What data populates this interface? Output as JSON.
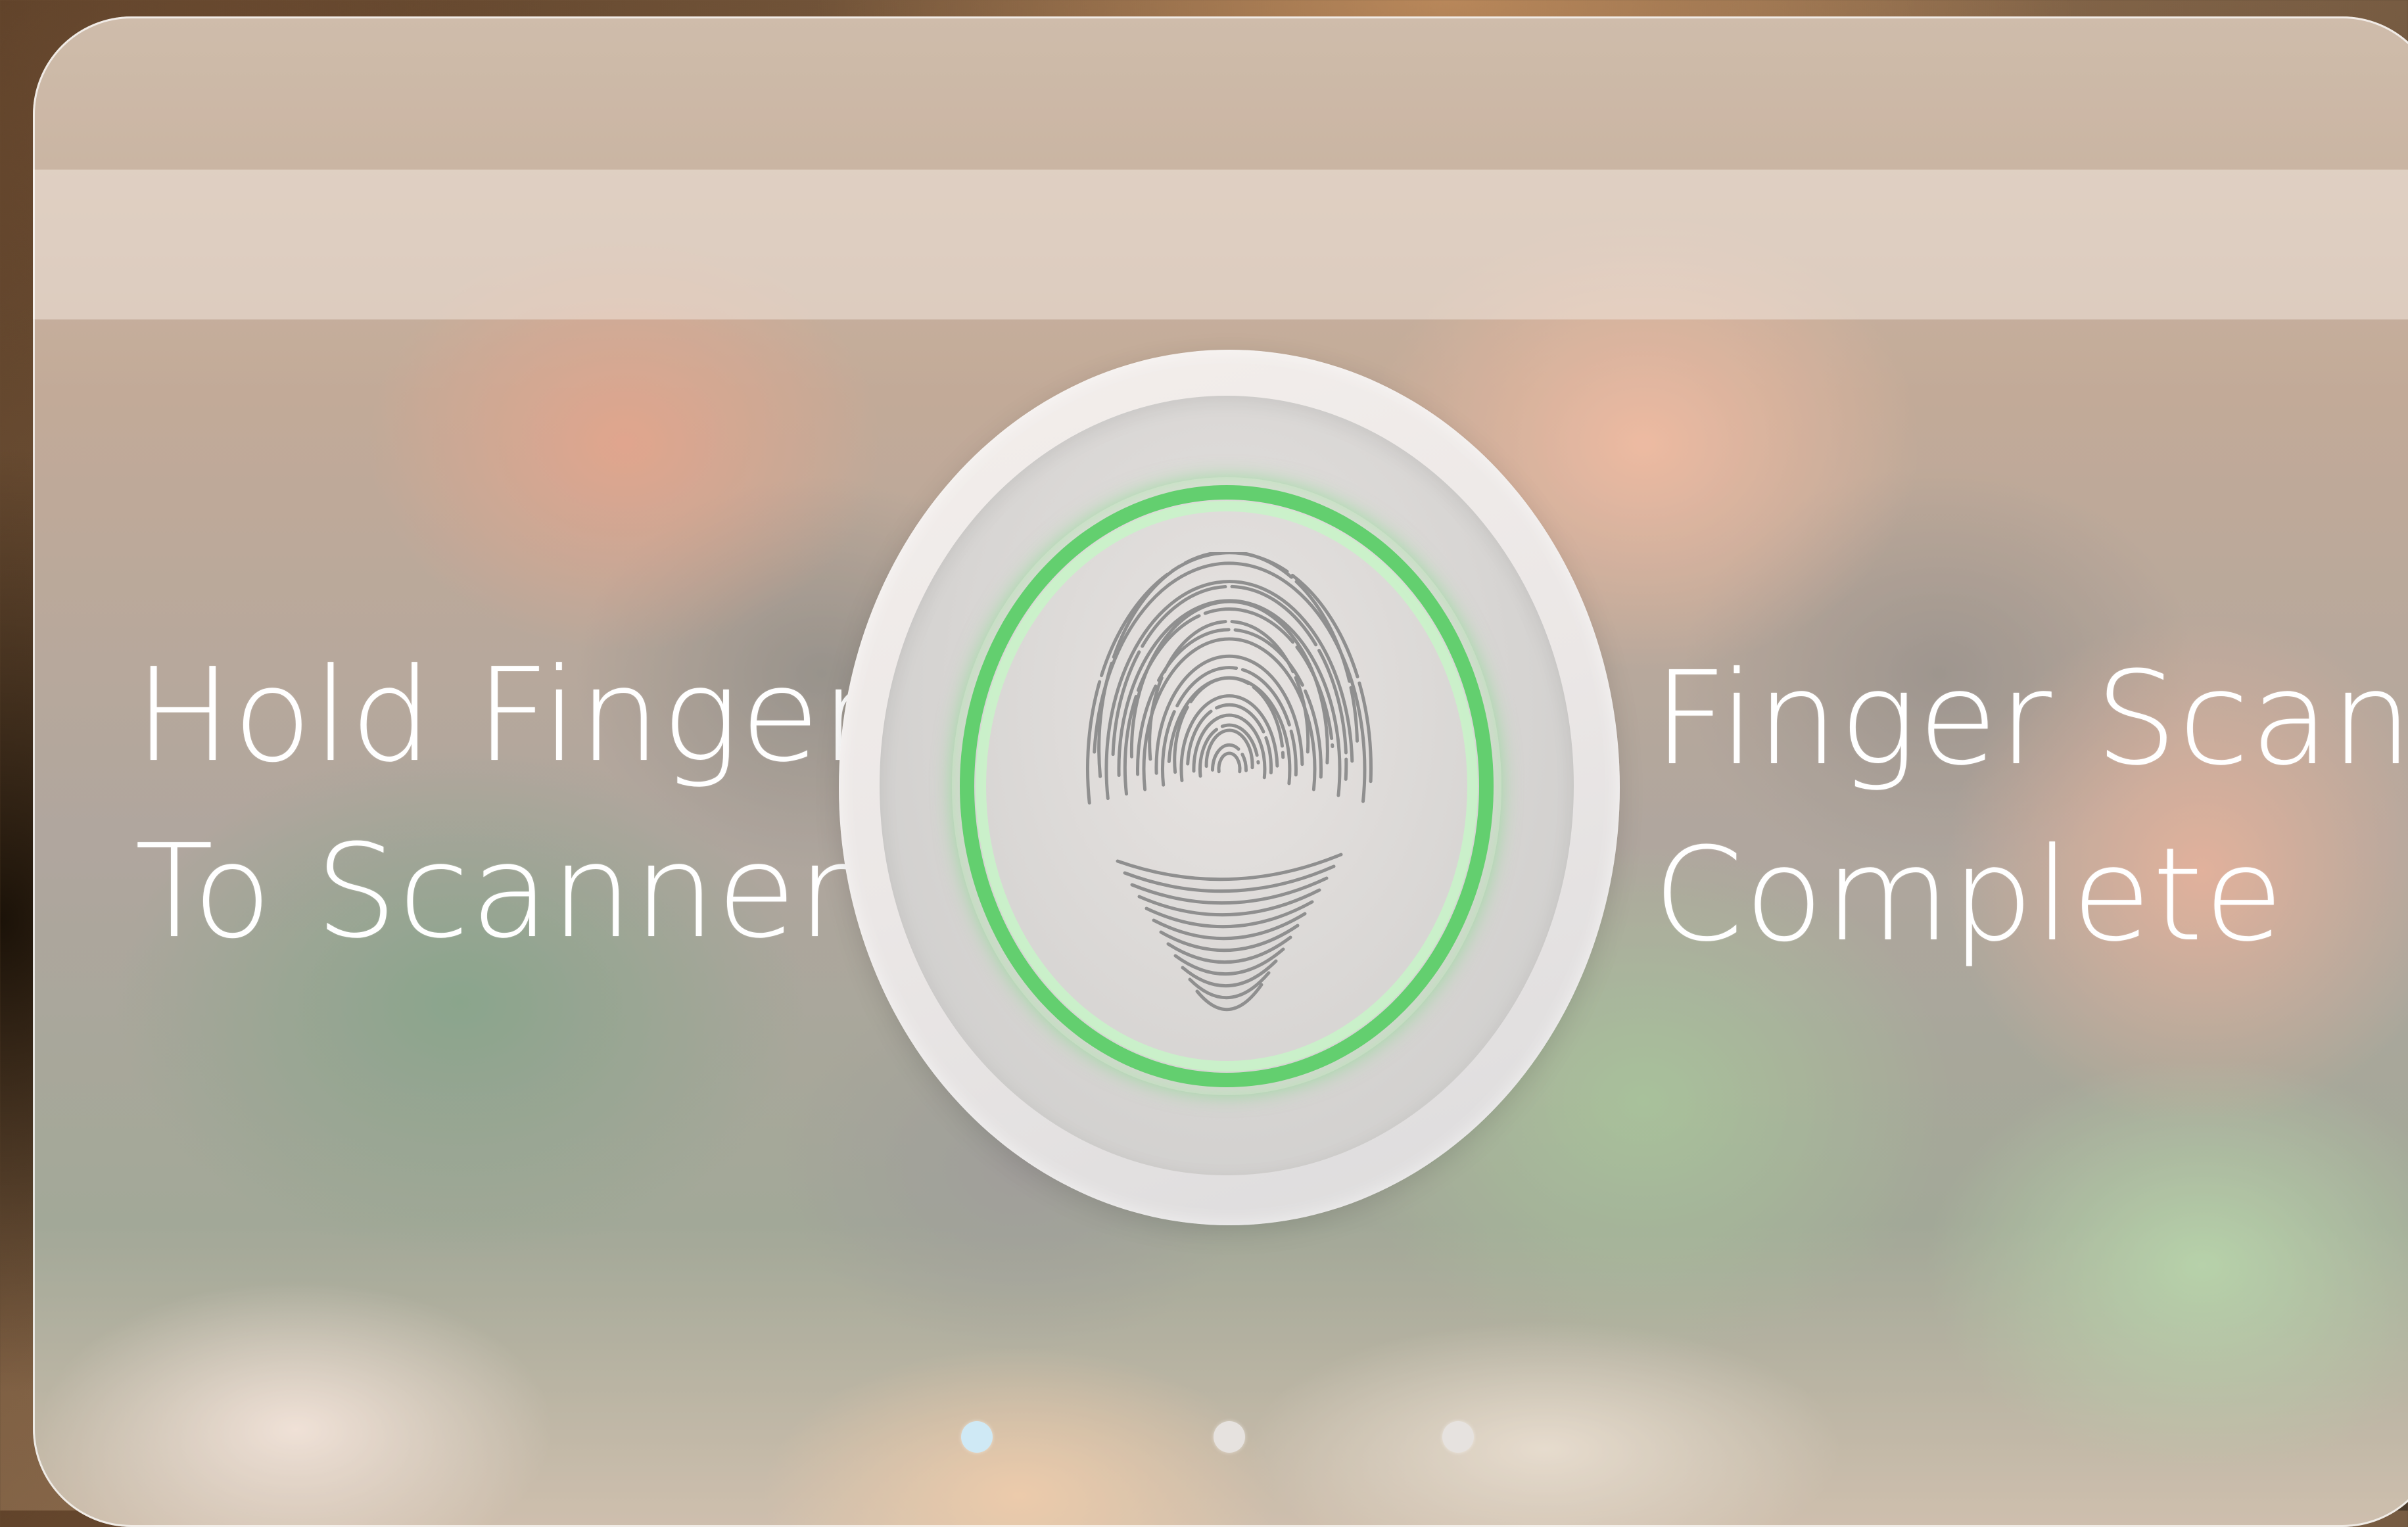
{
  "left_caption": {
    "line1": "Hold Finger",
    "line2": "To Scanner"
  },
  "right_caption": {
    "line1": "Finger Scan",
    "line2": "Complete"
  },
  "scanner": {
    "icon": "fingerprint-icon",
    "ring_color": "#63cf6f",
    "status": "complete"
  },
  "page_indicator": {
    "active_index": 0,
    "count": 3,
    "active_color": "#cfe9f5",
    "inactive_color": "#e6e2df"
  }
}
